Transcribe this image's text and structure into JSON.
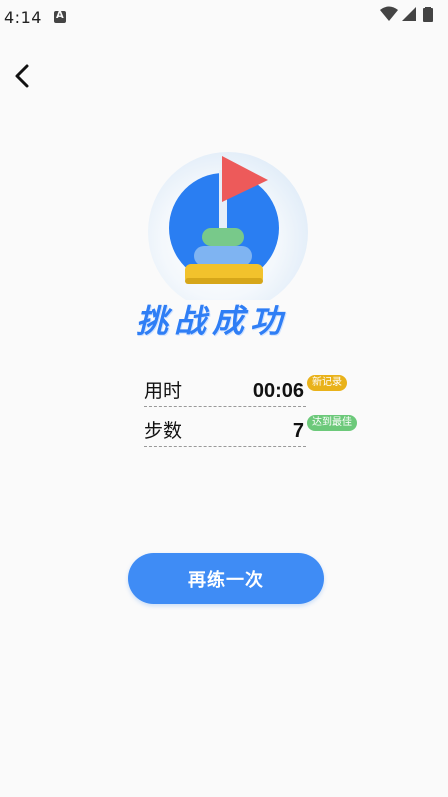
{
  "status_bar": {
    "time": "4:14",
    "notification_icon": "a-icon",
    "wifi_icon": "wifi-icon",
    "signal_icon": "signal-icon",
    "battery_icon": "battery-icon"
  },
  "nav": {
    "back_icon": "chevron-left-icon"
  },
  "hero": {
    "title": "挑战成功",
    "illustration": "hanoi-tower-flag-icon"
  },
  "stats": [
    {
      "label": "用时",
      "value": "00:06",
      "badge": "新记录",
      "badge_color": "#e9b21a"
    },
    {
      "label": "步数",
      "value": "7",
      "badge": "达到最佳",
      "badge_color": "#6cc97a"
    }
  ],
  "actions": {
    "retry_label": "再练一次"
  },
  "colors": {
    "accent": "#3f8cf5",
    "title": "#2f7ef5",
    "background": "#fafafa"
  }
}
